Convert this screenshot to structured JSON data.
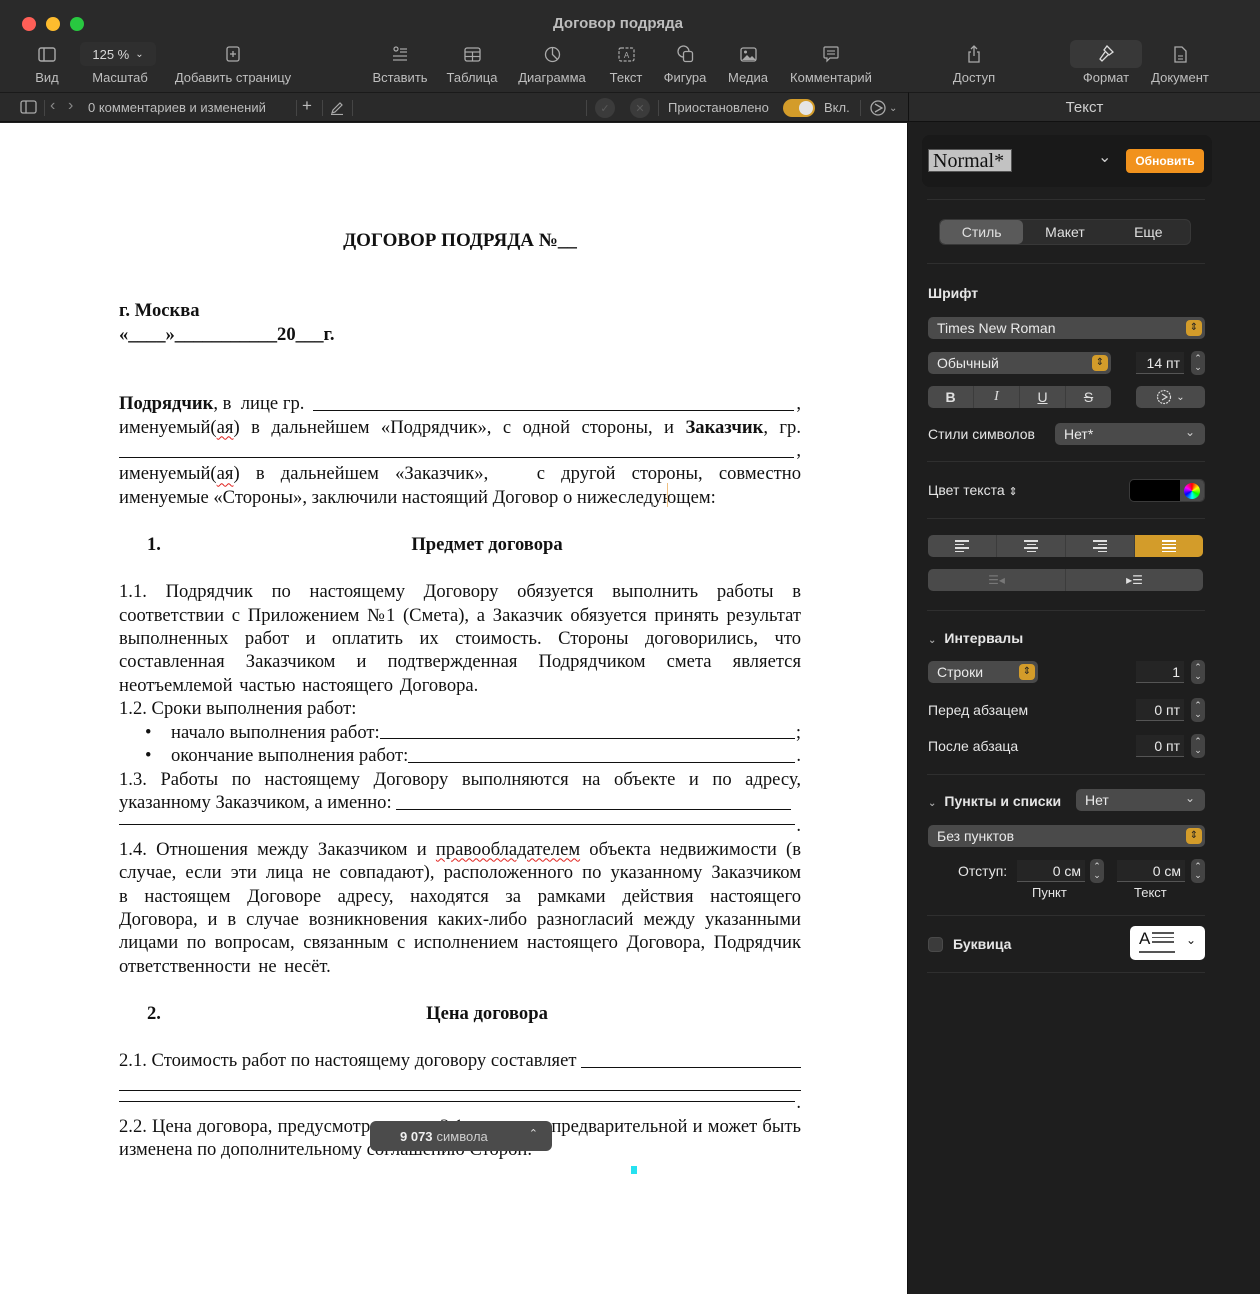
{
  "window": {
    "title": "Договор подряда",
    "traffic_colors": {
      "close": "#ff5f57",
      "minimize": "#febc2e",
      "zoom": "#28c840"
    }
  },
  "toolbar": {
    "view": "Вид",
    "zoom_value": "125 %",
    "zoom_label": "Масштаб",
    "add_page": "Добавить страницу",
    "insert": "Вставить",
    "table": "Таблица",
    "chart": "Диаграмма",
    "text": "Текст",
    "shape": "Фигура",
    "media": "Медиа",
    "comment": "Комментарий",
    "share": "Доступ",
    "format": "Формат",
    "document": "Документ"
  },
  "subbar": {
    "comments_count": "0 комментариев и изменений",
    "tracking_status": "Приостановлено",
    "tracking_toggle_label": "Вкл.",
    "tracking_on": true
  },
  "inspector": {
    "title": "Текст",
    "paragraph_style": "Normal*",
    "update_button": "Обновить",
    "tabs": [
      {
        "label": "Стиль",
        "active": true
      },
      {
        "label": "Макет",
        "active": false
      },
      {
        "label": "Еще",
        "active": false
      }
    ],
    "font_section": "Шрифт",
    "font_family": "Times New Roman",
    "font_typeface": "Обычный",
    "font_size": "14 пт",
    "style_buttons": [
      "B",
      "I",
      "U",
      "S"
    ],
    "char_styles_label": "Стили символов",
    "char_styles_value": "Нет*",
    "text_color_label": "Цвет текста",
    "text_color": "#000000",
    "alignment_active": "justify",
    "spacing_section": "Интервалы",
    "spacing_mode": "Строки",
    "spacing_value": "1",
    "before_paragraph_label": "Перед абзацем",
    "before_paragraph_value": "0 пт",
    "after_paragraph_label": "После абзаца",
    "after_paragraph_value": "0 пт",
    "bullets_section": "Пункты и списки",
    "bullets_value": "Нет",
    "bullets_type": "Без пунктов",
    "indent_label": "Отступ:",
    "indent_bullet_value": "0 см",
    "indent_text_value": "0 см",
    "indent_bullet_caption": "Пункт",
    "indent_text_caption": "Текст",
    "dropcap_label": "Буквица",
    "dropcap_checked": false,
    "accent_color": "#d39c2a",
    "update_color": "#f1921d"
  },
  "document": {
    "title": "ДОГОВОР ПОДРЯДА №__",
    "city": "г. Москва",
    "date_line": "«____»___________20___г.",
    "intro": {
      "contractor_bold": "Подрядчик",
      "p1a": ", в  лице гр. ",
      "p1b": ",",
      "p2a": "именуемый(",
      "p2sq": "ая",
      "p2b": ") в дальнейшем «Подрядчик», с одной стороны, и ",
      "customer_bold": "Заказчик",
      "p2c": ", гр.",
      "p3": ",",
      "p4a": "именуемый(",
      "p4sq": "ая",
      "p4b": ") в дальнейшем «Заказчик»,   с другой стороны, совместно",
      "p5": "именуемые «Стороны», заключили настоящий Договор о нижеследующем:"
    },
    "section1": {
      "num": "1.",
      "title": "Предмет договора"
    },
    "s1_1": "1.1. Подрядчик по настоящему Договору обязуется выполнить работы в соответствии с Приложением №1 (Смета), а Заказчик обязуется принять результат выполненных работ и оплатить их стоимость. Стороны договорились, что составленная Заказчиком и подтвержденная Подрядчиком смета является неотъемлемой частью настоящего Договора.",
    "s1_2": "1.2. Сроки выполнения работ:",
    "s1_2_items": [
      "начало выполнения работ:",
      "окончание выполнения работ:"
    ],
    "s1_2_ends": [
      ";",
      "."
    ],
    "s1_3": "1.3. Работы по настоящему Договору выполняются на объекте и по адресу,",
    "s1_3b": "указанному Заказчиком, а именно: ",
    "s1_3end": ".",
    "s1_4a": "1.4. Отношения между Заказчиком и ",
    "s1_4sq": "правообладателем",
    "s1_4b": " объекта недвижимости (в случае, если эти лица не совпадают), расположенного по указанному Заказчиком в  настоящем Договоре адресу, находятся за рамками действия настоящего Договора, и в случае возникновения каких-либо разногласий между указанными лицами   по вопросам, связанным с исполнением настоящего Договора, Подрядчик ответственности не несёт.",
    "section2": {
      "num": "2.",
      "title": "Цена договора"
    },
    "s2_1": "2.1. Стоимость работ по настоящему договору составляет ",
    "s2_1end": ".",
    "s2_2": "2.2. Цена договора, предусмотренная п .2.1., является предварительной и может быть изменена по дополнительному соглашению Сторон."
  },
  "status": {
    "char_count": "9 073",
    "char_label": "символа"
  }
}
